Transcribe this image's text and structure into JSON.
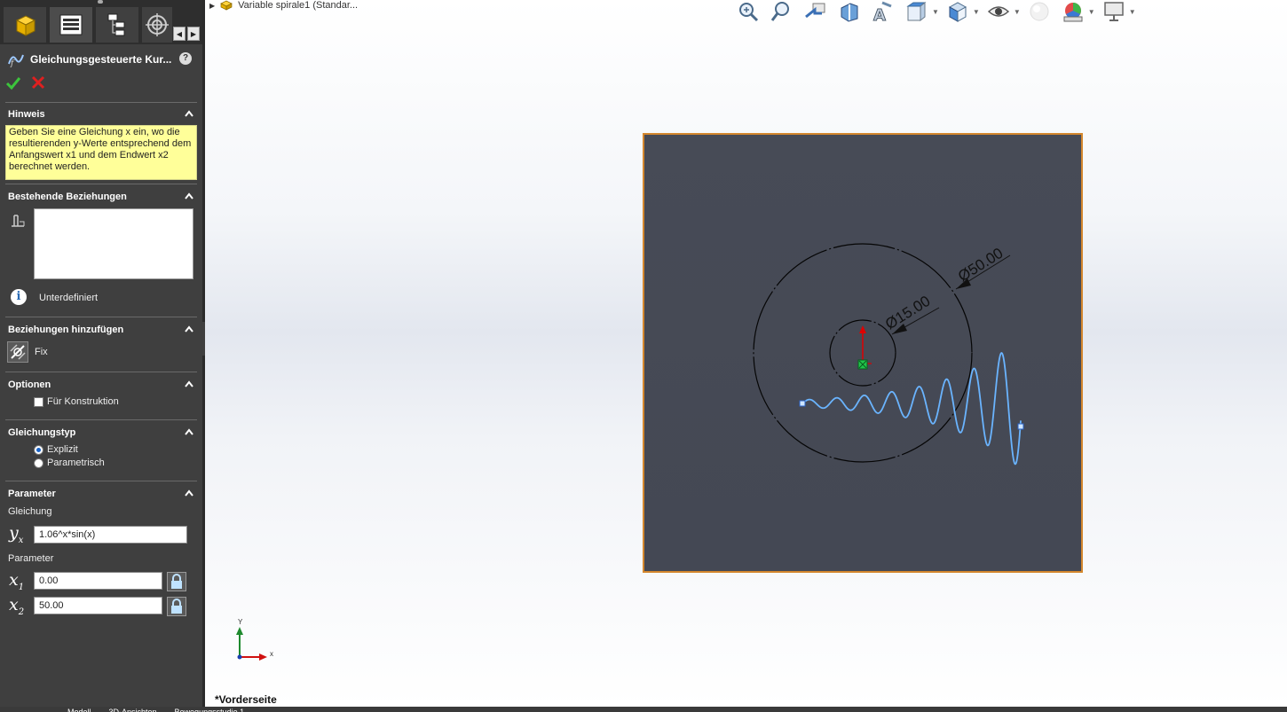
{
  "property_manager": {
    "title": "Gleichungsgesteuerte Kur...",
    "help_icon": "?",
    "sections": {
      "hinweis": {
        "title": "Hinweis",
        "text": "Geben Sie eine Gleichung x ein, wo die resultierenden y-Werte entsprechend dem Anfangswert x1 und dem Endwert x2 berechnet werden."
      },
      "bestehende": {
        "title": "Bestehende Beziehungen",
        "status": "Unterdefiniert"
      },
      "hinzufuegen": {
        "title": "Beziehungen hinzufügen",
        "fix_label": "Fix"
      },
      "optionen": {
        "title": "Optionen",
        "construction_label": "Für Konstruktion",
        "construction_checked": false
      },
      "gleichungstyp": {
        "title": "Gleichungstyp",
        "options": [
          "Explizit",
          "Parametrisch"
        ],
        "selected": "Explizit"
      },
      "parameter": {
        "title": "Parameter",
        "equation_label": "Gleichung",
        "y_symbol": "y",
        "y_sub": "x",
        "equation_value": "1.06^x*sin(x)",
        "params_label": "Parameter",
        "x_symbol": "x",
        "x1_sub": "1",
        "x2_sub": "2",
        "x1_value": "0.00",
        "x2_value": "50.00"
      }
    }
  },
  "viewport": {
    "tree_item": "Variable spirale1  (Standar...",
    "view_name": "*Vorderseite",
    "triad": {
      "x": "x",
      "y": "Y"
    },
    "dimensions": {
      "outer": "Ø50.00",
      "inner": "Ø15.00"
    },
    "colors": {
      "plane_fill": "#464a55",
      "plane_border": "#d4872e",
      "curve": "#6ab4ff",
      "origin": "#21c44a",
      "axis_y": "#e00000"
    }
  },
  "headsup_icons": [
    "zoom-to-fit-icon",
    "zoom-to-area-icon",
    "previous-view-icon",
    "section-view-icon",
    "dynamic-annotation-icon",
    "view-orientation-icon",
    "display-style-icon",
    "hide-show-items-icon",
    "edit-appearance-icon",
    "apply-scene-icon",
    "view-settings-icon"
  ],
  "bottom_tabs": [
    "Modell",
    "3D-Ansichten",
    "Bewegungsstudie 1"
  ]
}
